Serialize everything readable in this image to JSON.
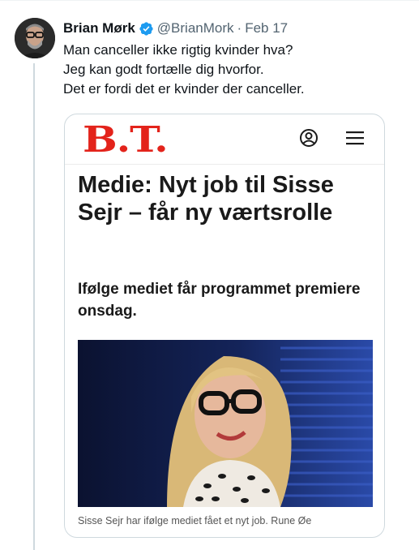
{
  "tweet": {
    "author_name": "Brian Mørk",
    "handle": "@BrianMork",
    "separator": "·",
    "date": "Feb 17",
    "lines": [
      "Man canceller ikke rigtig kvinder hva?",
      "Jeg kan godt fortælle dig hvorfor.",
      "Det er fordi det er kvinder der canceller."
    ]
  },
  "card": {
    "logo_text": "B.T.",
    "headline": "Medie: Nyt job til Sisse Sejr – får ny værtsrolle",
    "subhead": "Ifølge mediet får programmet premiere onsdag.",
    "caption": "Sisse Sejr har ifølge mediet fået et nyt job. Rune Øe"
  },
  "icons": {
    "verified": "verified-badge-icon",
    "user": "user-account-icon",
    "menu": "hamburger-menu-icon"
  },
  "colors": {
    "brand_red": "#e3231b",
    "verified_blue": "#1d9bf0",
    "muted_text": "#536471"
  }
}
